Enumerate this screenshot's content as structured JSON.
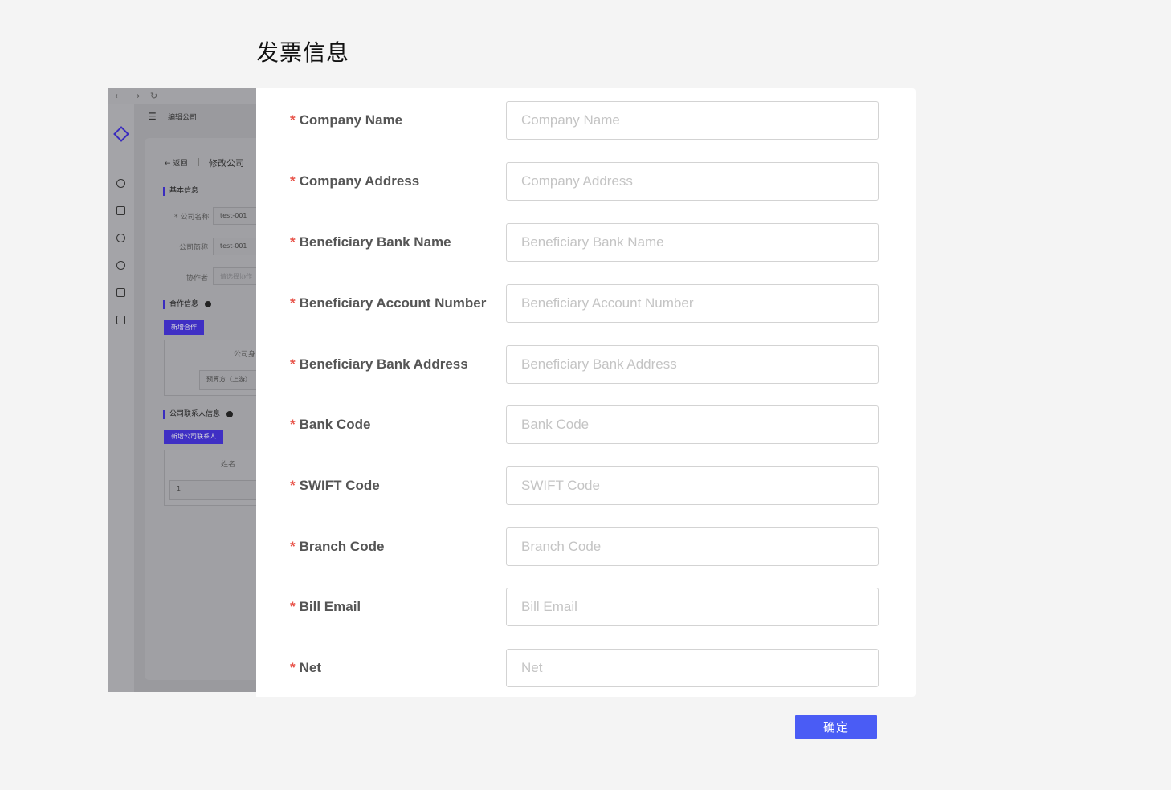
{
  "page": {
    "title": "发票信息",
    "confirm_label": "确定"
  },
  "background_app": {
    "nav": {
      "back": "←",
      "forward": "→",
      "reload": "↻"
    },
    "header_menu_icon": "☰",
    "header_title": "编辑公司",
    "breadcrumb_back": "← 返回",
    "breadcrumb_title": "修改公司",
    "section_basic": "基本信息",
    "field_company_name_label": "* 公司名称",
    "field_company_name_value": "test-001",
    "field_company_short_label": "公司简称",
    "field_company_short_value": "test-001",
    "field_collaborator_label": "协作者",
    "field_collaborator_placeholder": "请选择协作",
    "section_cooperation": "合作信息",
    "add_cooperation_button": "新增合作",
    "coop_table_header": "公司身",
    "coop_table_cell": "预算方（上游）",
    "section_contacts": "公司联系人信息",
    "add_contact_button": "新增公司联系人",
    "contact_table_header": "姓名",
    "contact_table_cell": "1"
  },
  "form": {
    "fields": [
      {
        "label": "Company Name",
        "placeholder": "Company Name",
        "value": ""
      },
      {
        "label": "Company Address",
        "placeholder": "Company Address",
        "value": ""
      },
      {
        "label": "Beneficiary Bank Name",
        "placeholder": "Beneficiary Bank Name",
        "value": ""
      },
      {
        "label": "Beneficiary Account Number",
        "placeholder": "Beneficiary Account Number",
        "value": ""
      },
      {
        "label": "Beneficiary Bank Address",
        "placeholder": "Beneficiary Bank Address",
        "value": ""
      },
      {
        "label": "Bank Code",
        "placeholder": "Bank Code",
        "value": ""
      },
      {
        "label": "SWIFT Code",
        "placeholder": "SWIFT Code",
        "value": ""
      },
      {
        "label": "Branch Code",
        "placeholder": "Branch Code",
        "value": ""
      },
      {
        "label": "Bill Email",
        "placeholder": "Bill Email",
        "value": ""
      },
      {
        "label": "Net",
        "placeholder": "Net",
        "value": ""
      }
    ],
    "required_mark": "*"
  },
  "colors": {
    "accent": "#4a5cf5",
    "required": "#e8544a",
    "background": "#f4f4f4"
  }
}
